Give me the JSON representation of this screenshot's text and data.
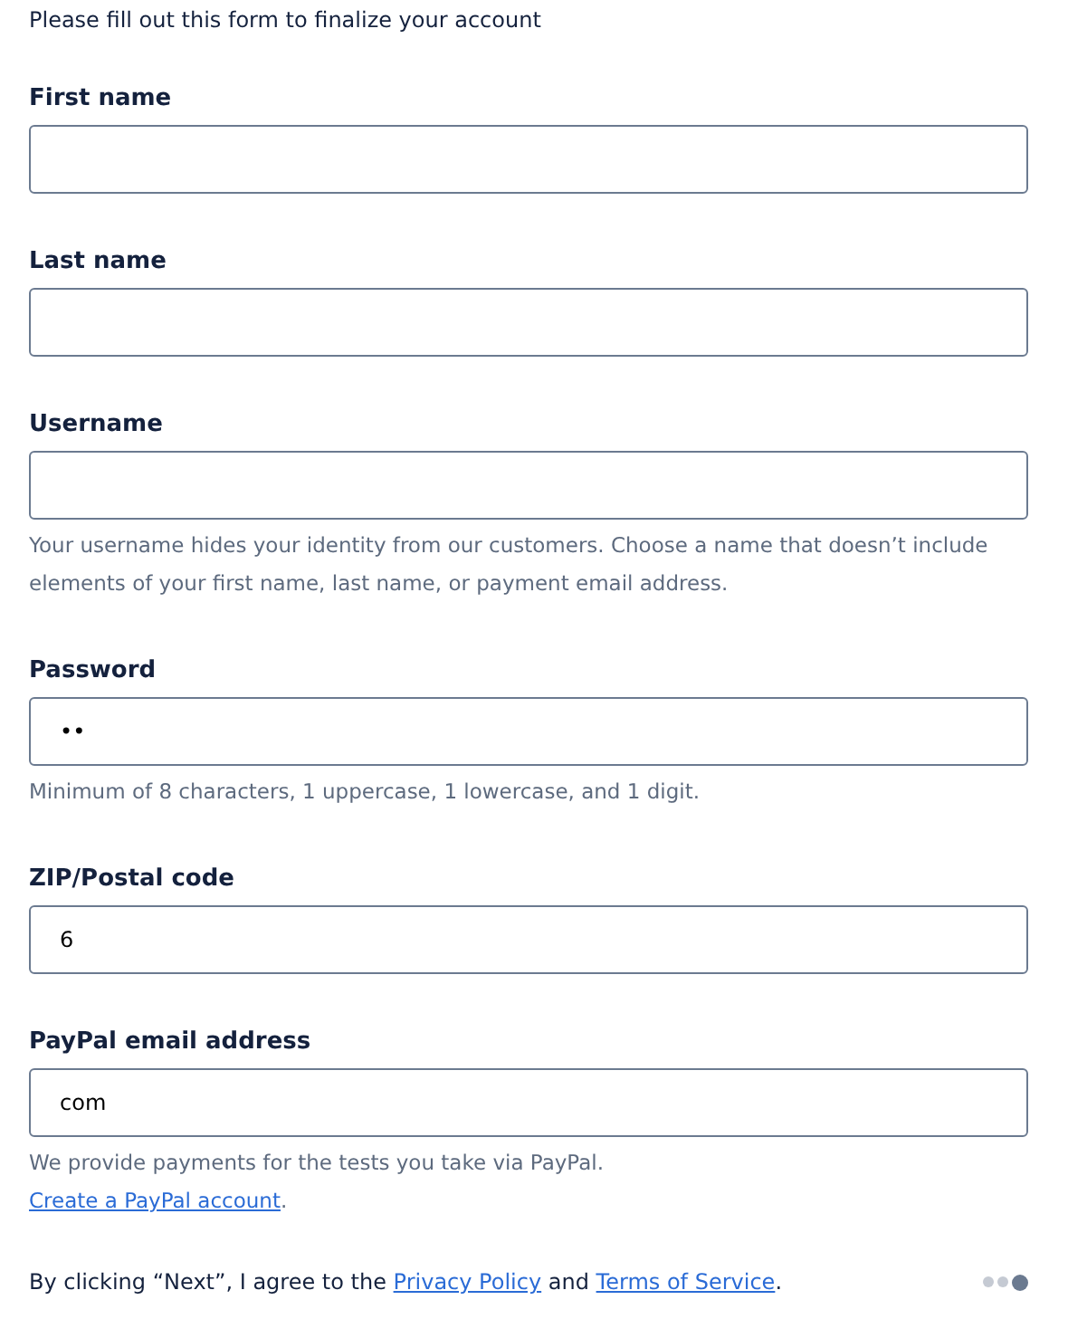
{
  "intro": "Please fill out this form to finalize your account",
  "fields": [
    {
      "label": "First name"
    },
    {
      "label": "Last name"
    },
    {
      "label": "Username",
      "help": [
        [
          {
            "kind": "text",
            "text": "Your username hides your identity from our customers. Choose a name that doesn’t include elements of your first name, last name, or payment email address."
          }
        ]
      ]
    },
    {
      "label": "Password",
      "value": "••",
      "help": [
        [
          {
            "kind": "text",
            "text": "Minimum of 8 characters, 1 uppercase, 1 lowercase, and 1 digit."
          }
        ]
      ]
    },
    {
      "label": "ZIP/Postal code",
      "value": "6"
    },
    {
      "label": "PayPal email address",
      "value": "com",
      "help": [
        [
          {
            "kind": "text",
            "text": "We provide payments for the tests you take via PayPal."
          }
        ],
        [
          {
            "kind": "link",
            "text": "Create a PayPal account"
          },
          {
            "kind": "text",
            "text": "."
          }
        ]
      ]
    }
  ],
  "footer": [
    {
      "kind": "text",
      "text": "By clicking “Next”, I agree to the "
    },
    {
      "kind": "link",
      "text": "Privacy Policy"
    },
    {
      "kind": "text",
      "text": " and "
    },
    {
      "kind": "link",
      "text": "Terms of Service"
    },
    {
      "kind": "text",
      "text": "."
    }
  ],
  "steps": [
    {
      "selected": false
    },
    {
      "selected": false
    },
    {
      "selected": true
    }
  ]
}
